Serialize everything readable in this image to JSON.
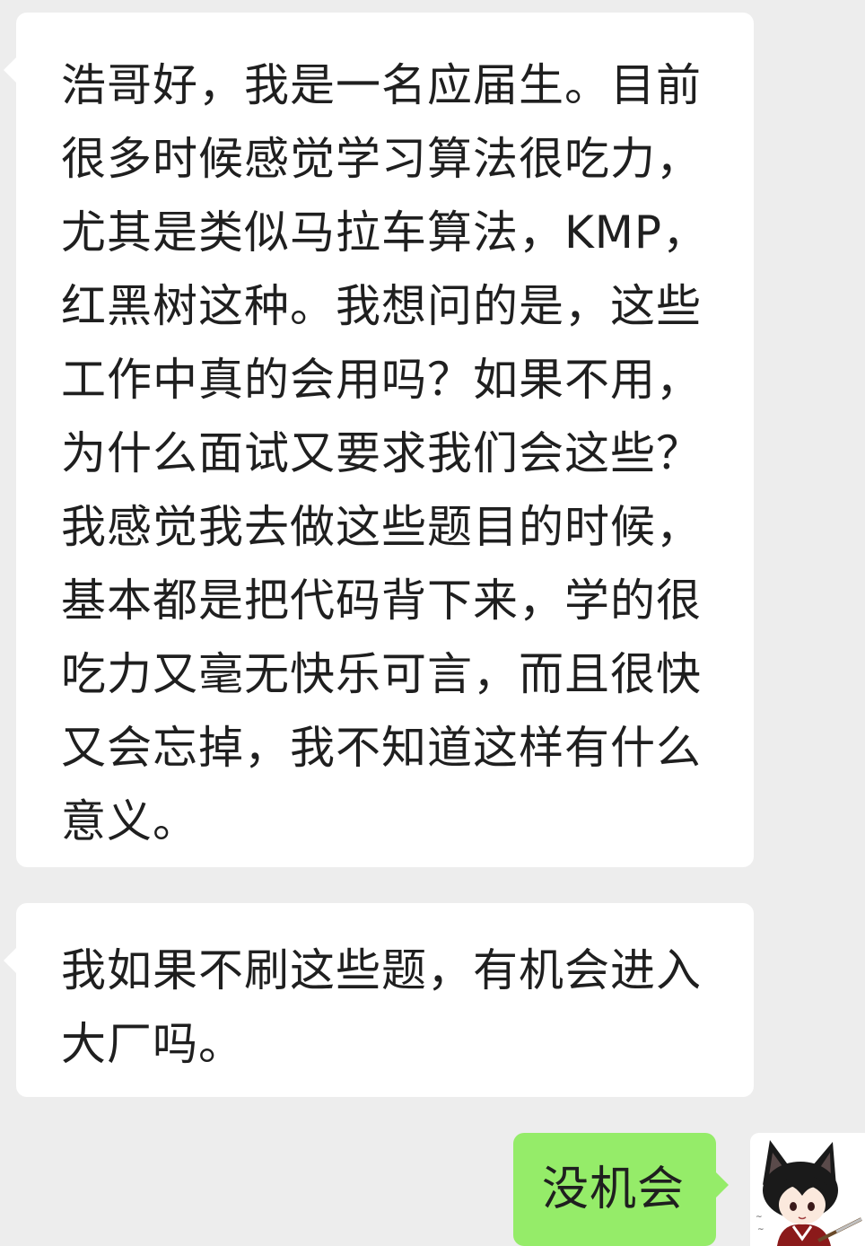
{
  "chat": {
    "messages": [
      {
        "direction": "incoming",
        "text": "浩哥好，我是一名应届生。目前很多时候感觉学习算法很吃力，尤其是类似马拉车算法，KMP，红黑树这种。我想问的是，这些工作中真的会用吗？如果不用，为什么面试又要求我们会这些？我感觉我去做这些题目的时候，基本都是把代码背下来，学的很吃力又毫无快乐可言，而且很快又会忘掉，我不知道这样有什么意义。"
      },
      {
        "direction": "incoming",
        "text": "我如果不刷这些题，有机会进入大厂吗。"
      },
      {
        "direction": "outgoing",
        "text": "没机会"
      }
    ],
    "self_avatar": {
      "icon": "anime-cat-girl-avatar-icon"
    }
  },
  "colors": {
    "background": "#ededed",
    "incoming_bubble": "#ffffff",
    "outgoing_bubble": "#95ec69",
    "text": "#1f1f1f"
  }
}
